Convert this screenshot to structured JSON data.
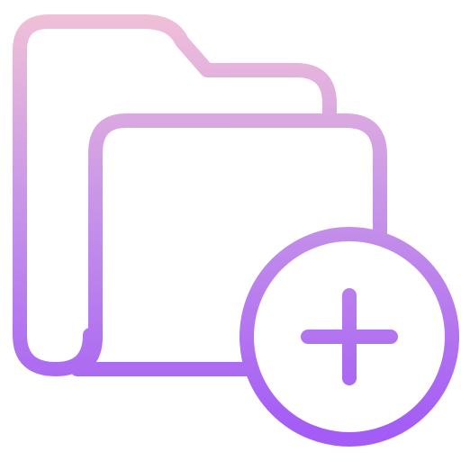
{
  "icon": {
    "name": "add-folder-icon",
    "parts": [
      "folder-back-icon",
      "folder-front-icon",
      "add-circle-icon",
      "plus-icon"
    ]
  },
  "colors": {
    "gradient_top": "#f0c0d8",
    "gradient_mid": "#c895e8",
    "gradient_bottom": "#a35cf5",
    "background": "#ffffff"
  }
}
